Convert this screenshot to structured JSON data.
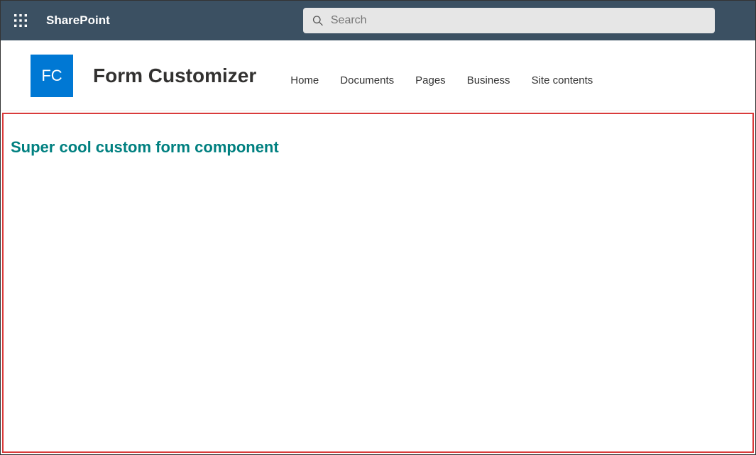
{
  "suiteBar": {
    "productName": "SharePoint",
    "search": {
      "placeholder": "Search"
    }
  },
  "siteHeader": {
    "logoText": "FC",
    "title": "Form Customizer",
    "nav": [
      {
        "label": "Home"
      },
      {
        "label": "Documents"
      },
      {
        "label": "Pages"
      },
      {
        "label": "Business"
      },
      {
        "label": "Site contents"
      }
    ]
  },
  "content": {
    "heading": "Super cool custom form component"
  }
}
